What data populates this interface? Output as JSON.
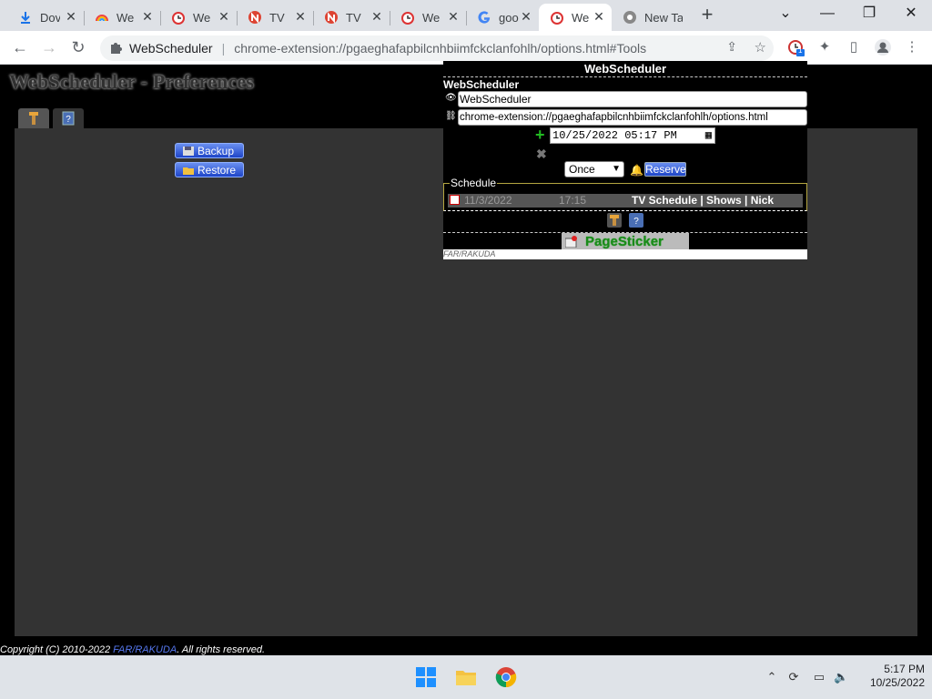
{
  "browser": {
    "tabs": [
      {
        "title": "Dov",
        "icon": "download-icon"
      },
      {
        "title": "We",
        "icon": "rainbow-icon"
      },
      {
        "title": "We",
        "icon": "clock-icon"
      },
      {
        "title": "TV",
        "icon": "n-logo-icon"
      },
      {
        "title": "TV",
        "icon": "n-logo-icon"
      },
      {
        "title": "We",
        "icon": "clock-icon"
      },
      {
        "title": "goo",
        "icon": "google-icon"
      },
      {
        "title": "We",
        "icon": "clock-icon"
      },
      {
        "title": "New Tab",
        "icon": "chrome-icon"
      }
    ],
    "active_tab_index": 7,
    "site_name": "WebScheduler",
    "url": "chrome-extension://pgaeghafapbilcnhbiimfckclanfohlh/options.html#Tools",
    "extension_badge": "1"
  },
  "page": {
    "title": "WebScheduler - Preferences",
    "backup_label": "Backup",
    "restore_label": "Restore",
    "copyright_prefix": "Copyright (C) 2010-2022 ",
    "copyright_link": "FAR/RAKUDA",
    "copyright_suffix": ". All rights reserved."
  },
  "popup": {
    "header": "WebScheduler",
    "subheader": "WebScheduler",
    "name_value": "WebScheduler",
    "url_value": "chrome-extension://pgaeghafapbilcnhbiimfckclanfohlh/options.html",
    "datetime_value": "10/25/2022 05:17 PM",
    "repeat_value": "Once",
    "reserve_label": "Reserve",
    "schedule_legend": "Schedule",
    "schedule_items": [
      {
        "date": "11/3/2022",
        "time": "17:15",
        "name": "TV Schedule | Shows | Nick"
      }
    ],
    "pagesticker_label": "PageSticker",
    "footer": "FAR/RAKUDA"
  },
  "taskbar": {
    "time": "5:17 PM",
    "date": "10/25/2022"
  }
}
